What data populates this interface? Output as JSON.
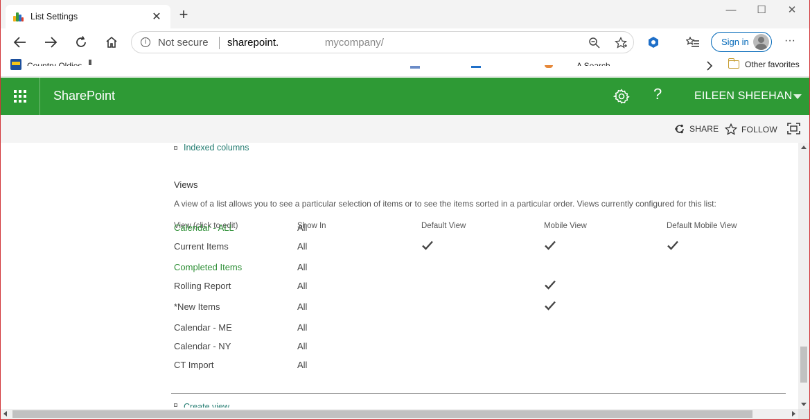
{
  "browser": {
    "tab_title": "List Settings",
    "close_tab": "✕",
    "new_tab": "+",
    "window_controls": {
      "minimize": "—",
      "maximize": "☐",
      "close": "✕"
    },
    "security": "Not secure",
    "url_host": "sharepoint.",
    "url_rest": "mycompany/",
    "sign_in": "Sign in",
    "more_menu": "···",
    "favorites": [
      {
        "label": "Country Oldies"
      },
      {
        "label": "A Search"
      }
    ],
    "other_favorites": "Other favorites"
  },
  "suite": {
    "brand": "SharePoint",
    "help": "?",
    "user": "EILEEN SHEEHAN"
  },
  "commands": {
    "share": "SHARE",
    "follow": "FOLLOW"
  },
  "content": {
    "indexed_columns_link": "Indexed columns",
    "views_title": "Views",
    "views_desc": "A view of a list allows you to see a particular selection of items or to see the items sorted in a particular order. Views currently configured for this list:",
    "headers": {
      "view": "View (click to edit)",
      "show_in": "Show In",
      "default_view": "Default View",
      "mobile_view": "Mobile View",
      "default_mobile_view": "Default Mobile View"
    },
    "views": [
      {
        "name": "Calendar - ALL",
        "show_in": "All",
        "link": true,
        "default": false,
        "mobile": false,
        "default_mobile": false
      },
      {
        "name": "Current Items",
        "show_in": "All",
        "link": false,
        "default": true,
        "mobile": true,
        "default_mobile": true
      },
      {
        "name": "Completed Items",
        "show_in": "All",
        "link": true,
        "default": false,
        "mobile": false,
        "default_mobile": false
      },
      {
        "name": "Rolling Report",
        "show_in": "All",
        "link": false,
        "default": false,
        "mobile": true,
        "default_mobile": false
      },
      {
        "name": "*New Items",
        "show_in": "All",
        "link": false,
        "default": false,
        "mobile": true,
        "default_mobile": false
      },
      {
        "name": "Calendar - ME",
        "show_in": "All",
        "link": false,
        "default": false,
        "mobile": false,
        "default_mobile": false
      },
      {
        "name": "Calendar - NY",
        "show_in": "All",
        "link": false,
        "default": false,
        "mobile": false,
        "default_mobile": false
      },
      {
        "name": "CT Import",
        "show_in": "All",
        "link": false,
        "default": false,
        "mobile": false,
        "default_mobile": false
      }
    ],
    "create_view_link": "Create view"
  },
  "colors": {
    "suite_green": "#2e9a35",
    "link_green": "#2e8f36",
    "teal_link": "#207a6f",
    "signin_blue": "#0067b8"
  }
}
